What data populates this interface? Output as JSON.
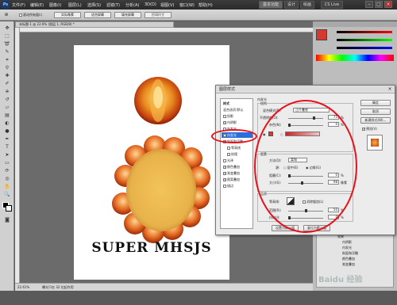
{
  "app": {
    "logo": "Ps"
  },
  "menu": [
    "文件(F)",
    "编辑(E)",
    "图像(I)",
    "图层(L)",
    "选择(S)",
    "滤镜(T)",
    "分析(A)",
    "3D(D)",
    "视图(V)",
    "窗口(W)",
    "帮助(H)"
  ],
  "menubar_right": {
    "workspace": "基本功能",
    "design": "设计",
    "painting": "绘画",
    "cslive": "CS Live"
  },
  "options_bar": {
    "checkbox_label": "滚动所有窗口",
    "buttons": [
      "实际像素",
      "适合屏幕",
      "填充屏幕",
      "打印尺寸"
    ]
  },
  "document": {
    "tab_label": "未标题-1 @ 22.6% (图层 1, RGB/8) *",
    "zoom": "22.61%",
    "status_text": "曝光只在 32 位起作用",
    "canvas_text": "SUPER MHSJS"
  },
  "dialog": {
    "title": "图层样式",
    "styles_header": "样式",
    "blend_options": "混合选项:默认",
    "style_items": [
      {
        "label": "投影",
        "checked": false
      },
      {
        "label": "内阴影",
        "checked": true
      },
      {
        "label": "外发光",
        "checked": false
      },
      {
        "label": "内发光",
        "checked": true,
        "selected": true
      },
      {
        "label": "斜面和浮雕",
        "checked": true
      },
      {
        "label": "等高线",
        "checked": false
      },
      {
        "label": "纹理",
        "checked": false
      },
      {
        "label": "光泽",
        "checked": false
      },
      {
        "label": "颜色叠加",
        "checked": true
      },
      {
        "label": "渐变叠加",
        "checked": true
      },
      {
        "label": "图案叠加",
        "checked": true
      },
      {
        "label": "描边",
        "checked": false
      }
    ],
    "inner_glow": {
      "section_title": "内发光",
      "structure_title": "结构",
      "blend_mode_label": "混合模式(B):",
      "blend_mode_value": "正片叠底",
      "opacity_label": "不透明度(O):",
      "opacity_value": "75",
      "opacity_percent": 0.75,
      "noise_label": "杂色(N):",
      "noise_value": "0",
      "noise_percent": 0,
      "elements_title": "图素",
      "method_label": "方法(Q):",
      "method_value": "柔和",
      "source_label": "源:",
      "source_center": "居中(E)",
      "source_edge": "边缘(G)",
      "choke_label": "阻塞(C):",
      "choke_value": "0",
      "choke_percent": 0,
      "size_label": "大小(S):",
      "size_value": "98",
      "size_unit": "像素",
      "size_percent": 0.39,
      "quality_title": "品质",
      "contour_label": "等高线:",
      "antialias_label": "消除锯齿(L)",
      "range_label": "范围(R):",
      "range_value": "50",
      "range_percent": 0.5,
      "jitter_label": "抖动(J):",
      "jitter_value": "0",
      "jitter_percent": 0,
      "percent": "%",
      "default_button": "设置为默认值",
      "reset_button": "复位为默认值"
    },
    "buttons": {
      "ok": "确定",
      "cancel": "取消",
      "new_style": "新建样式(W)...",
      "preview": "预览(V)"
    }
  },
  "layers_panel": {
    "layer_name": "图层 1",
    "effects_label": "效果",
    "effect_items": [
      "内阴影",
      "内发光",
      "斜面和浮雕",
      "颜色叠加",
      "渐变叠加"
    ],
    "watermark": "Baidu 经验"
  },
  "colors": {
    "accent": "#2a6edb",
    "annotation": "#e8101a",
    "glow": "#d63a2e"
  }
}
